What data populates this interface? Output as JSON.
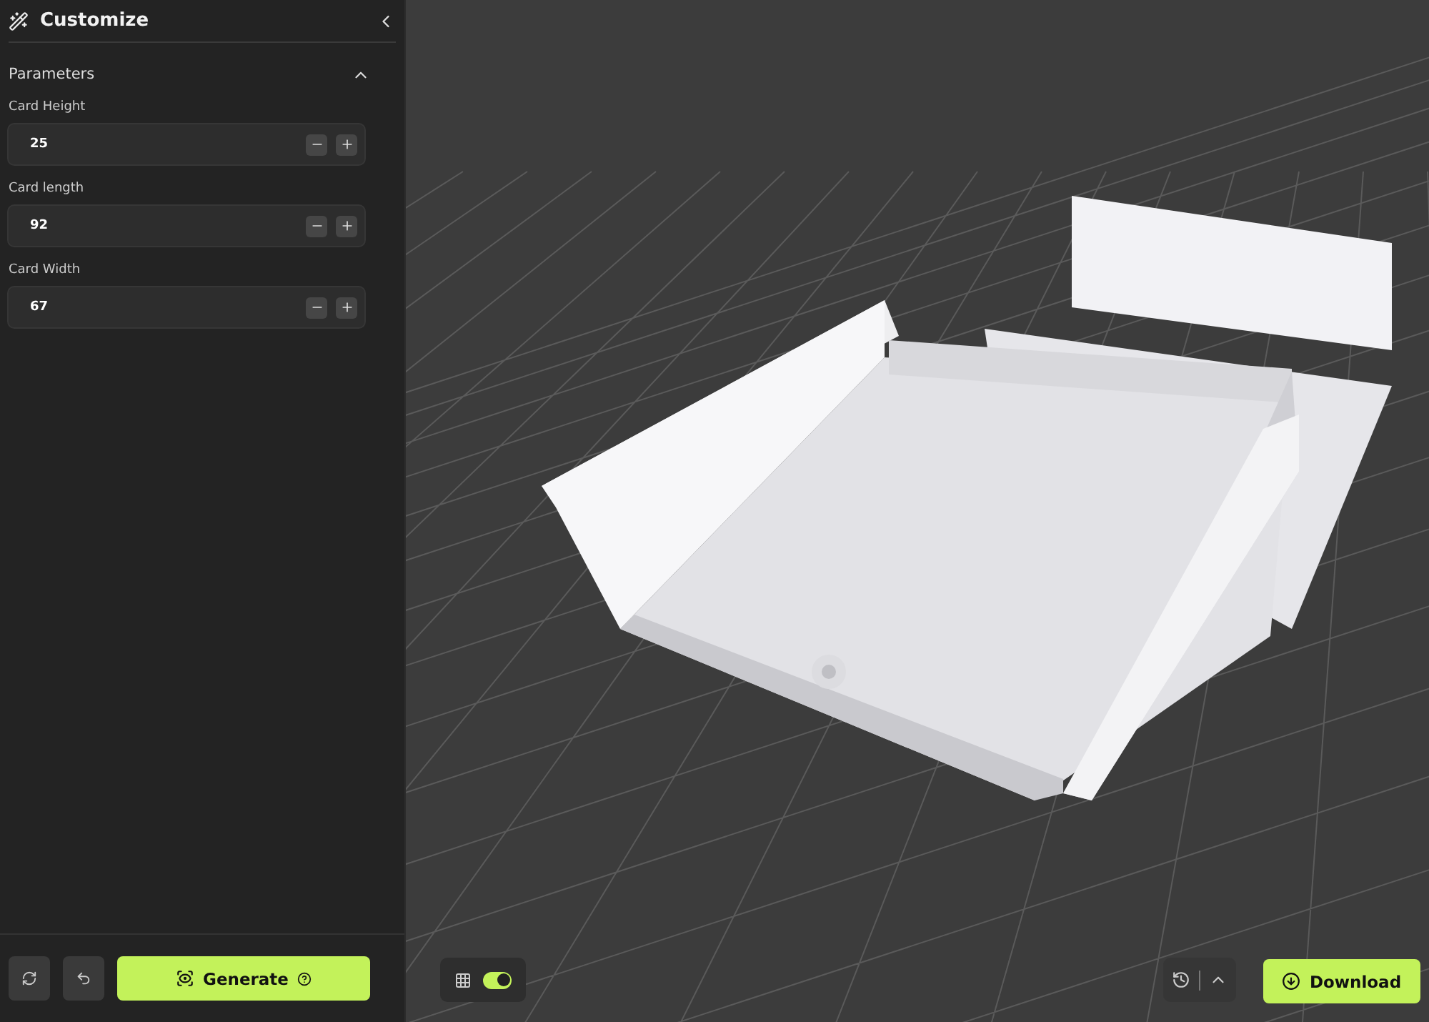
{
  "sidebar": {
    "title": "Customize",
    "section": {
      "title": "Parameters",
      "expanded": true,
      "parameters": [
        {
          "label": "Card Height",
          "value": "25"
        },
        {
          "label": "Card length",
          "value": "92"
        },
        {
          "label": "Card Width",
          "value": "67"
        }
      ]
    },
    "generate_button": "Generate"
  },
  "viewport": {
    "grid_toggle": {
      "on": true
    },
    "download_button": "Download"
  }
}
